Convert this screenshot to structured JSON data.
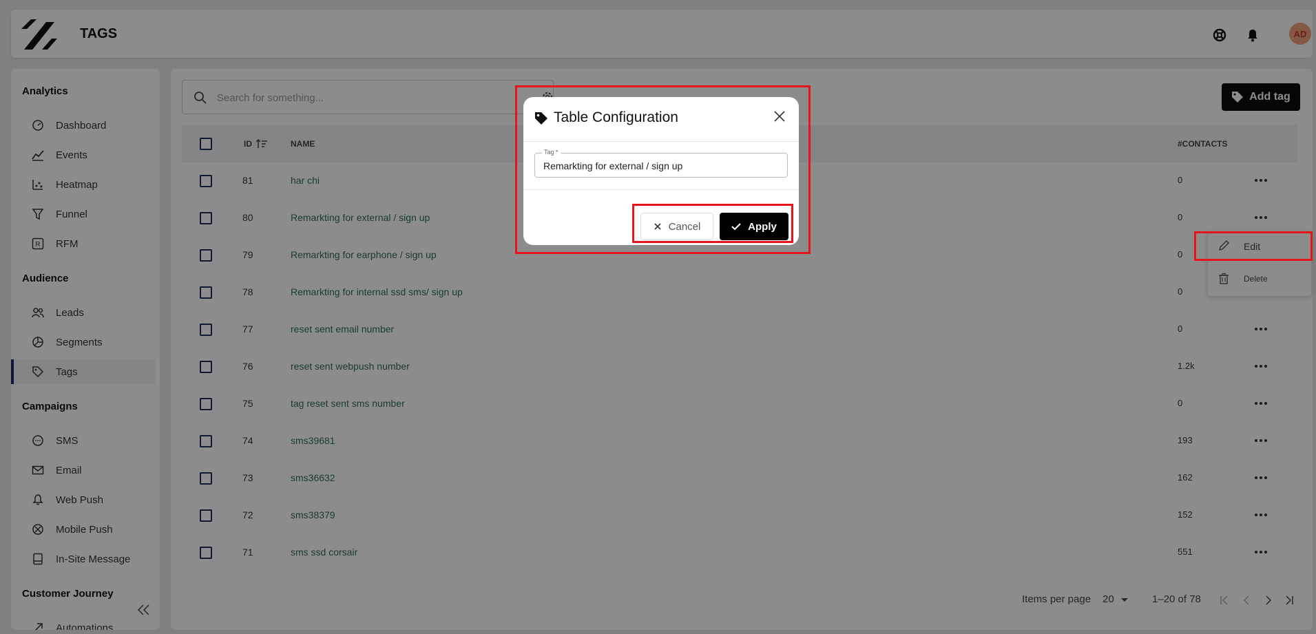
{
  "header": {
    "title": "TAGS",
    "avatar_initials": "AD"
  },
  "sidebar": {
    "sections": [
      {
        "title": "Analytics",
        "items": [
          {
            "label": "Dashboard",
            "icon": "dashboard-icon"
          },
          {
            "label": "Events",
            "icon": "chart-line-icon"
          },
          {
            "label": "Heatmap",
            "icon": "heatmap-icon"
          },
          {
            "label": "Funnel",
            "icon": "funnel-icon"
          },
          {
            "label": "RFM",
            "icon": "rfm-icon"
          }
        ]
      },
      {
        "title": "Audience",
        "items": [
          {
            "label": "Leads",
            "icon": "users-icon"
          },
          {
            "label": "Segments",
            "icon": "pie-chart-icon"
          },
          {
            "label": "Tags",
            "icon": "tag-icon"
          }
        ]
      },
      {
        "title": "Campaigns",
        "items": [
          {
            "label": "SMS",
            "icon": "sms-icon"
          },
          {
            "label": "Email",
            "icon": "email-icon"
          },
          {
            "label": "Web Push",
            "icon": "bell-icon"
          },
          {
            "label": "Mobile Push",
            "icon": "mobile-push-icon"
          },
          {
            "label": "In-Site Message",
            "icon": "in-site-message-icon"
          }
        ]
      },
      {
        "title": "Customer Journey",
        "items": [
          {
            "label": "Automations",
            "icon": "automation-icon"
          }
        ]
      }
    ]
  },
  "main": {
    "search_placeholder": "Search for something...",
    "add_button": "Add tag",
    "columns": {
      "id": "ID",
      "name": "NAME",
      "contacts": "#CONTACTS"
    },
    "rows": [
      {
        "id": "81",
        "name": "har chi",
        "contacts": "0"
      },
      {
        "id": "80",
        "name": "Remarkting for external / sign up",
        "contacts": "0"
      },
      {
        "id": "79",
        "name": "Remarkting for earphone / sign up",
        "contacts": "0"
      },
      {
        "id": "78",
        "name": "Remarkting for internal ssd sms/ sign up",
        "contacts": "0"
      },
      {
        "id": "77",
        "name": "reset sent email number",
        "contacts": "0"
      },
      {
        "id": "76",
        "name": "reset sent webpush number",
        "contacts": "1.2k"
      },
      {
        "id": "75",
        "name": "tag reset sent sms number",
        "contacts": "0"
      },
      {
        "id": "74",
        "name": "sms39681",
        "contacts": "193"
      },
      {
        "id": "73",
        "name": "sms36632",
        "contacts": "162"
      },
      {
        "id": "72",
        "name": "sms38379",
        "contacts": "152"
      },
      {
        "id": "71",
        "name": "sms ssd corsair",
        "contacts": "551"
      }
    ],
    "pagination": {
      "items_per_page_label": "Items per page",
      "items_per_page": "20",
      "range": "1–20 of 78"
    }
  },
  "row_menu": {
    "edit": "Edit",
    "delete": "Delete"
  },
  "modal": {
    "title": "Table Configuration",
    "field_label": "Tag *",
    "field_value": "Remarkting for external / sign up",
    "cancel": "Cancel",
    "apply": "Apply"
  },
  "colors": {
    "accent_dark": "#000000",
    "highlight": "#e8141b",
    "link_green": "#2f6f4f",
    "nav_active": "#1a2b6d"
  }
}
